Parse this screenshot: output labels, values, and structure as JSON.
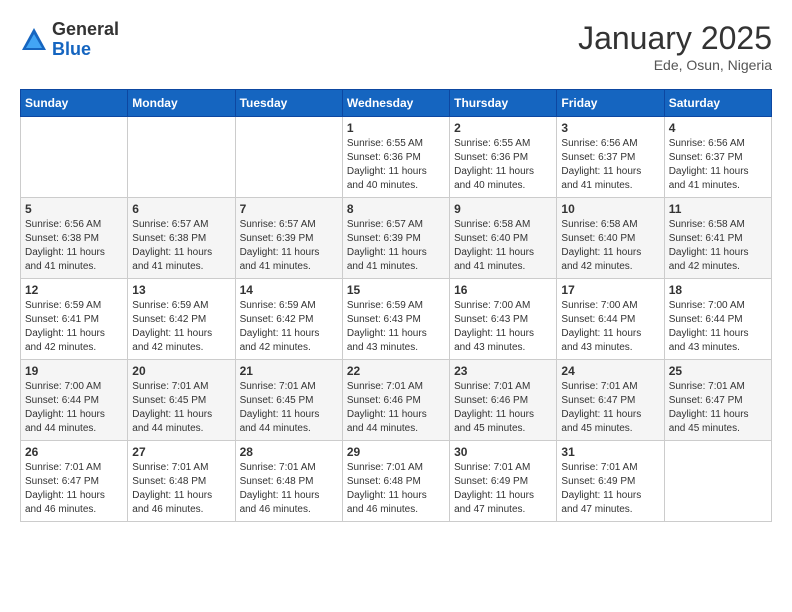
{
  "header": {
    "logo_general": "General",
    "logo_blue": "Blue",
    "month_title": "January 2025",
    "location": "Ede, Osun, Nigeria"
  },
  "days_of_week": [
    "Sunday",
    "Monday",
    "Tuesday",
    "Wednesday",
    "Thursday",
    "Friday",
    "Saturday"
  ],
  "weeks": [
    [
      {
        "day": "",
        "info": ""
      },
      {
        "day": "",
        "info": ""
      },
      {
        "day": "",
        "info": ""
      },
      {
        "day": "1",
        "info": "Sunrise: 6:55 AM\nSunset: 6:36 PM\nDaylight: 11 hours\nand 40 minutes."
      },
      {
        "day": "2",
        "info": "Sunrise: 6:55 AM\nSunset: 6:36 PM\nDaylight: 11 hours\nand 40 minutes."
      },
      {
        "day": "3",
        "info": "Sunrise: 6:56 AM\nSunset: 6:37 PM\nDaylight: 11 hours\nand 41 minutes."
      },
      {
        "day": "4",
        "info": "Sunrise: 6:56 AM\nSunset: 6:37 PM\nDaylight: 11 hours\nand 41 minutes."
      }
    ],
    [
      {
        "day": "5",
        "info": "Sunrise: 6:56 AM\nSunset: 6:38 PM\nDaylight: 11 hours\nand 41 minutes."
      },
      {
        "day": "6",
        "info": "Sunrise: 6:57 AM\nSunset: 6:38 PM\nDaylight: 11 hours\nand 41 minutes."
      },
      {
        "day": "7",
        "info": "Sunrise: 6:57 AM\nSunset: 6:39 PM\nDaylight: 11 hours\nand 41 minutes."
      },
      {
        "day": "8",
        "info": "Sunrise: 6:57 AM\nSunset: 6:39 PM\nDaylight: 11 hours\nand 41 minutes."
      },
      {
        "day": "9",
        "info": "Sunrise: 6:58 AM\nSunset: 6:40 PM\nDaylight: 11 hours\nand 41 minutes."
      },
      {
        "day": "10",
        "info": "Sunrise: 6:58 AM\nSunset: 6:40 PM\nDaylight: 11 hours\nand 42 minutes."
      },
      {
        "day": "11",
        "info": "Sunrise: 6:58 AM\nSunset: 6:41 PM\nDaylight: 11 hours\nand 42 minutes."
      }
    ],
    [
      {
        "day": "12",
        "info": "Sunrise: 6:59 AM\nSunset: 6:41 PM\nDaylight: 11 hours\nand 42 minutes."
      },
      {
        "day": "13",
        "info": "Sunrise: 6:59 AM\nSunset: 6:42 PM\nDaylight: 11 hours\nand 42 minutes."
      },
      {
        "day": "14",
        "info": "Sunrise: 6:59 AM\nSunset: 6:42 PM\nDaylight: 11 hours\nand 42 minutes."
      },
      {
        "day": "15",
        "info": "Sunrise: 6:59 AM\nSunset: 6:43 PM\nDaylight: 11 hours\nand 43 minutes."
      },
      {
        "day": "16",
        "info": "Sunrise: 7:00 AM\nSunset: 6:43 PM\nDaylight: 11 hours\nand 43 minutes."
      },
      {
        "day": "17",
        "info": "Sunrise: 7:00 AM\nSunset: 6:44 PM\nDaylight: 11 hours\nand 43 minutes."
      },
      {
        "day": "18",
        "info": "Sunrise: 7:00 AM\nSunset: 6:44 PM\nDaylight: 11 hours\nand 43 minutes."
      }
    ],
    [
      {
        "day": "19",
        "info": "Sunrise: 7:00 AM\nSunset: 6:44 PM\nDaylight: 11 hours\nand 44 minutes."
      },
      {
        "day": "20",
        "info": "Sunrise: 7:01 AM\nSunset: 6:45 PM\nDaylight: 11 hours\nand 44 minutes."
      },
      {
        "day": "21",
        "info": "Sunrise: 7:01 AM\nSunset: 6:45 PM\nDaylight: 11 hours\nand 44 minutes."
      },
      {
        "day": "22",
        "info": "Sunrise: 7:01 AM\nSunset: 6:46 PM\nDaylight: 11 hours\nand 44 minutes."
      },
      {
        "day": "23",
        "info": "Sunrise: 7:01 AM\nSunset: 6:46 PM\nDaylight: 11 hours\nand 45 minutes."
      },
      {
        "day": "24",
        "info": "Sunrise: 7:01 AM\nSunset: 6:47 PM\nDaylight: 11 hours\nand 45 minutes."
      },
      {
        "day": "25",
        "info": "Sunrise: 7:01 AM\nSunset: 6:47 PM\nDaylight: 11 hours\nand 45 minutes."
      }
    ],
    [
      {
        "day": "26",
        "info": "Sunrise: 7:01 AM\nSunset: 6:47 PM\nDaylight: 11 hours\nand 46 minutes."
      },
      {
        "day": "27",
        "info": "Sunrise: 7:01 AM\nSunset: 6:48 PM\nDaylight: 11 hours\nand 46 minutes."
      },
      {
        "day": "28",
        "info": "Sunrise: 7:01 AM\nSunset: 6:48 PM\nDaylight: 11 hours\nand 46 minutes."
      },
      {
        "day": "29",
        "info": "Sunrise: 7:01 AM\nSunset: 6:48 PM\nDaylight: 11 hours\nand 46 minutes."
      },
      {
        "day": "30",
        "info": "Sunrise: 7:01 AM\nSunset: 6:49 PM\nDaylight: 11 hours\nand 47 minutes."
      },
      {
        "day": "31",
        "info": "Sunrise: 7:01 AM\nSunset: 6:49 PM\nDaylight: 11 hours\nand 47 minutes."
      },
      {
        "day": "",
        "info": ""
      }
    ]
  ]
}
